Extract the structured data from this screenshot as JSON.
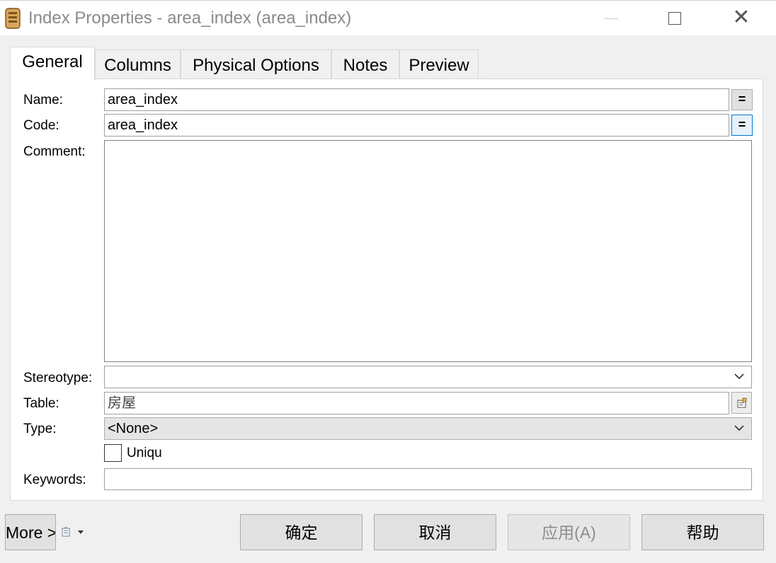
{
  "window": {
    "title": "Index Properties - area_index (area_index)",
    "icon": "index-properties-icon",
    "controls": {
      "minimize": "minimize-icon",
      "maximize": "maximize-icon",
      "close": "close-icon"
    }
  },
  "tabs": [
    {
      "label": "General",
      "active": true
    },
    {
      "label": "Columns",
      "active": false
    },
    {
      "label": "Physical Options",
      "active": false
    },
    {
      "label": "Notes",
      "active": false
    },
    {
      "label": "Preview",
      "active": false
    }
  ],
  "form": {
    "name_label": "Name:",
    "name_value": "area_index",
    "code_label": "Code:",
    "code_value": "area_index",
    "equals_label": "=",
    "comment_label": "Comment:",
    "comment_value": "",
    "stereotype_label": "Stereotype:",
    "stereotype_value": "",
    "table_label": "Table:",
    "table_value": "房屋",
    "type_label": "Type:",
    "type_value": "<None>",
    "unique_label": "Uniqu",
    "unique_checked": false,
    "keywords_label": "Keywords:",
    "keywords_value": ""
  },
  "footer": {
    "more_label": "More >>",
    "ok_label": "确定",
    "cancel_label": "取消",
    "apply_label": "应用(A)",
    "help_label": "帮助"
  },
  "colors": {
    "accent": "#0078d7",
    "title_text": "#8a8a8a",
    "disabled_text": "#8c8c8c"
  }
}
